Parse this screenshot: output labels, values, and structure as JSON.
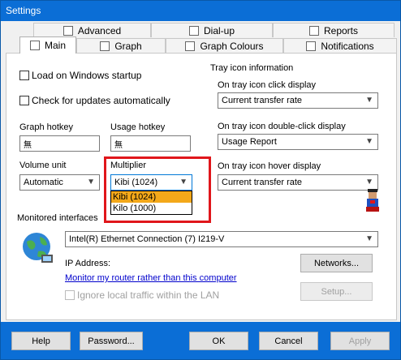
{
  "window": {
    "title": "Settings"
  },
  "tabs": {
    "row1": [
      {
        "label": "Advanced",
        "icon": "advanced-icon"
      },
      {
        "label": "Dial-up",
        "icon": "dialup-icon"
      },
      {
        "label": "Reports",
        "icon": "reports-icon"
      }
    ],
    "row2": [
      {
        "label": "Main",
        "icon": "main-icon",
        "active": true
      },
      {
        "label": "Graph",
        "icon": "graph-icon"
      },
      {
        "label": "Graph Colours",
        "icon": "graph-colours-icon"
      },
      {
        "label": "Notifications",
        "icon": "notifications-icon"
      }
    ]
  },
  "main": {
    "load_on_startup": {
      "label": "Load on Windows startup",
      "checked": false
    },
    "check_updates": {
      "label": "Check for updates automatically",
      "checked": false
    },
    "graph_hotkey": {
      "label": "Graph hotkey",
      "value": "無"
    },
    "usage_hotkey": {
      "label": "Usage hotkey",
      "value": "無"
    },
    "volume_unit": {
      "label": "Volume unit",
      "value": "Automatic"
    },
    "multiplier": {
      "label": "Multiplier",
      "value": "Kibi (1024)",
      "options": [
        "Kibi (1024)",
        "Kilo (1000)"
      ],
      "selected": "Kibi (1024)"
    },
    "tray": {
      "group_label": "Tray icon information",
      "click_label": "On tray icon click display",
      "click_value": "Current transfer rate",
      "dblclick_label": "On tray icon double-click display",
      "dblclick_value": "Usage Report",
      "hover_label": "On tray icon hover display",
      "hover_value": "Current transfer rate"
    },
    "interfaces": {
      "group_label": "Monitored interfaces",
      "adapter": "Intel(R) Ethernet Connection (7) I219-V",
      "ip_label": "IP Address:",
      "router_link": "Monitor my router rather than this computer",
      "ignore_lan": {
        "label": "Ignore local traffic within the LAN",
        "checked": false,
        "disabled": true
      },
      "networks_button": "Networks...",
      "setup_button": "Setup..."
    }
  },
  "footer": {
    "help": "Help",
    "password": "Password...",
    "ok": "OK",
    "cancel": "Cancel",
    "apply": "Apply"
  },
  "colors": {
    "title_bar": "#0b6ed6",
    "highlight": "#e0161b",
    "dropdown_selected": "#f3a81a",
    "link": "#0000cc"
  }
}
